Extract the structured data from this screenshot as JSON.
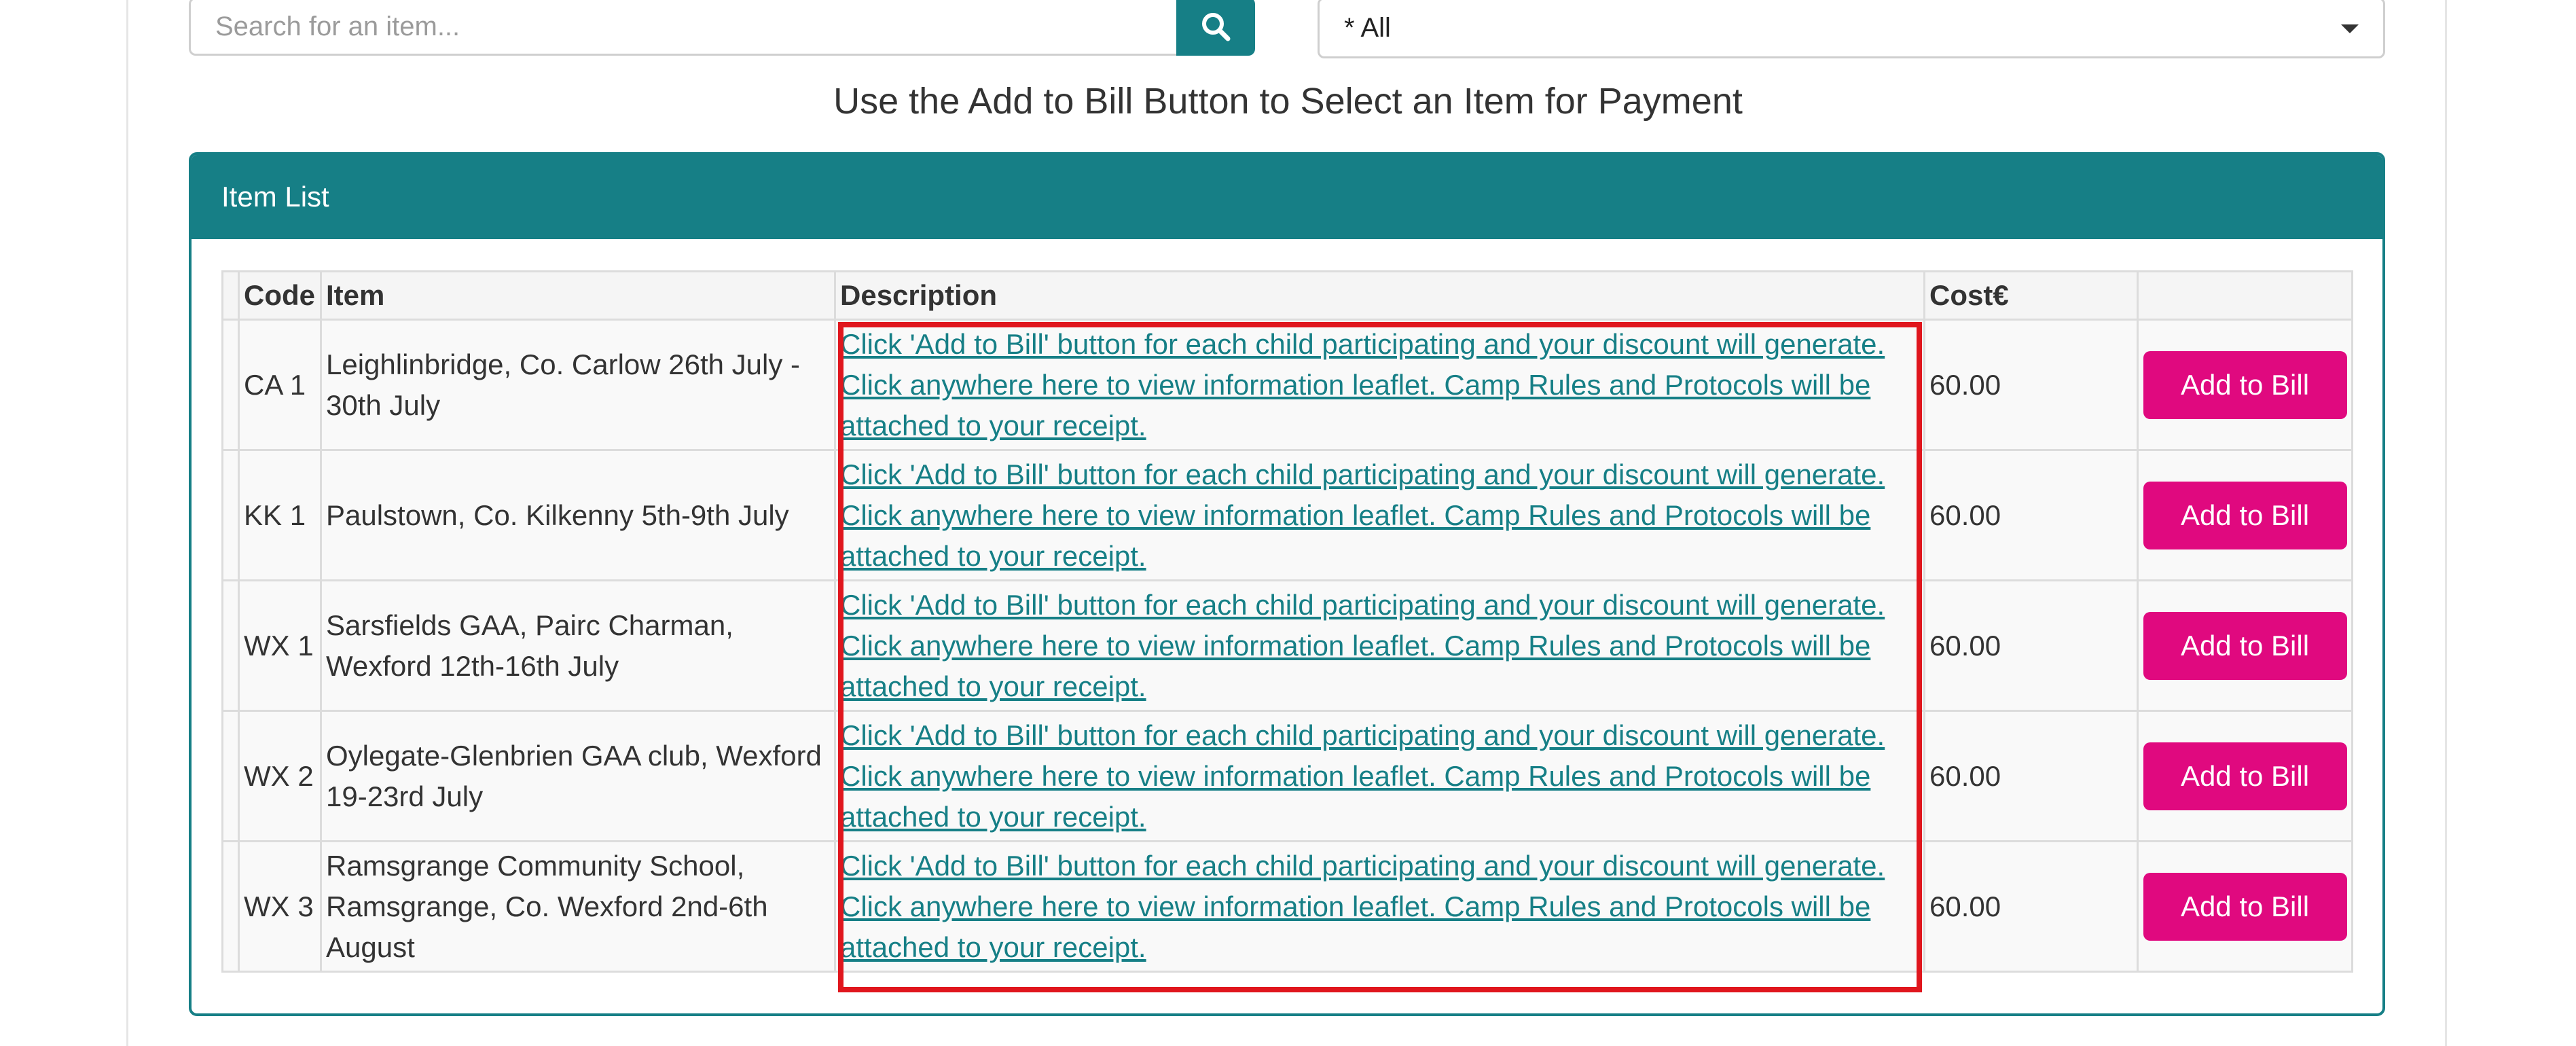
{
  "search": {
    "placeholder": "Search for an item...",
    "icon": "search-icon"
  },
  "category_select": {
    "selected": "* All",
    "icon": "caret-down-icon"
  },
  "instruction": "Use the Add to Bill Button to Select an Item for Payment",
  "panel": {
    "title": "Item List"
  },
  "table": {
    "headers": {
      "code": "Code",
      "item": "Item",
      "description": "Description",
      "cost": "Cost€",
      "action": ""
    },
    "rows": [
      {
        "code": "CA 1",
        "item": "Leighlinbridge, Co. Carlow 26th July - 30th July",
        "description": "Click 'Add to Bill' button for each child participating and your discount will generate. Click anywhere here to view information leaflet. Camp Rules and Protocols will be attached to your receipt.",
        "cost": "60.00",
        "button": "Add to Bill"
      },
      {
        "code": "KK 1",
        "item": "Paulstown, Co. Kilkenny 5th-9th July",
        "description": "Click 'Add to Bill' button for each child participating and your discount will generate. Click anywhere here to view information leaflet. Camp Rules and Protocols will be attached to your receipt.",
        "cost": "60.00",
        "button": "Add to Bill"
      },
      {
        "code": "WX 1",
        "item": "Sarsfields GAA, Pairc Charman, Wexford 12th-16th July",
        "description": "Click 'Add to Bill' button for each child participating and your discount will generate. Click anywhere here to view information leaflet. Camp Rules and Protocols will be attached to your receipt.",
        "cost": "60.00",
        "button": "Add to Bill"
      },
      {
        "code": "WX 2",
        "item": "Oylegate-Glenbrien GAA club, Wexford 19-23rd July",
        "description": "Click 'Add to Bill' button for each child participating and your discount will generate. Click anywhere here to view information leaflet. Camp Rules and Protocols will be attached to your receipt.",
        "cost": "60.00",
        "button": "Add to Bill"
      },
      {
        "code": "WX 3",
        "item": "Ramsgrange Community School, Ramsgrange, Co. Wexford 2nd-6th August",
        "description": "Click 'Add to Bill' button for each child participating and your discount will generate. Click anywhere here to view information leaflet. Camp Rules and Protocols will be attached to your receipt.",
        "cost": "60.00",
        "button": "Add to Bill"
      }
    ]
  },
  "colors": {
    "accent": "#167f86",
    "button": "#e0097f",
    "highlight": "#e0161d"
  }
}
